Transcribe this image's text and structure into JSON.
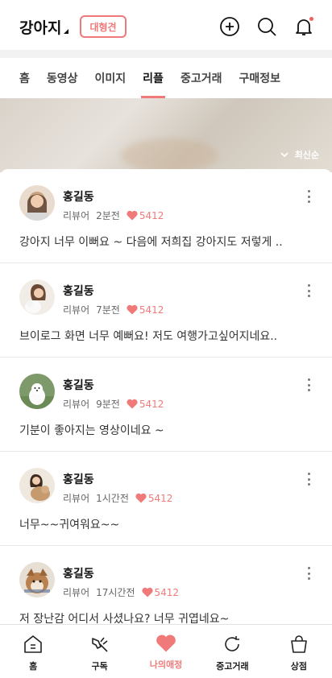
{
  "header": {
    "brand": "강아지",
    "size_chip": "대형견"
  },
  "tabs": [
    {
      "label": "홈",
      "active": false
    },
    {
      "label": "동영상",
      "active": false
    },
    {
      "label": "이미지",
      "active": false
    },
    {
      "label": "리플",
      "active": true
    },
    {
      "label": "중고거래",
      "active": false
    },
    {
      "label": "구매정보",
      "active": false
    }
  ],
  "sort": {
    "label": "최신순"
  },
  "comments": [
    {
      "name": "홍길동",
      "role": "리뷰어",
      "time": "2분전",
      "likes": "5412",
      "text": "강아지 너무 이뻐요 ~ 다음에 저희집 강아지도 저렇게 ..",
      "avatar_color": "#8a6a52"
    },
    {
      "name": "홍길동",
      "role": "리뷰어",
      "time": "7분전",
      "likes": "5412",
      "text": "브이로그 화면 너무 예뻐요! 저도 여행가고싶어지네요..",
      "avatar_color": "#d8c8b8"
    },
    {
      "name": "홍길동",
      "role": "리뷰어",
      "time": "9분전",
      "likes": "5412",
      "text": "기분이 좋아지는 영상이네요 ~",
      "avatar_color": "#7f9a6a"
    },
    {
      "name": "홍길동",
      "role": "리뷰어",
      "time": "1시간전",
      "likes": "5412",
      "text": "너무~~귀여워요~~",
      "avatar_color": "#b89a7a"
    },
    {
      "name": "홍길동",
      "role": "리뷰어",
      "time": "17시간전",
      "likes": "5412",
      "text": "저 장난감 어디서 사셨나요? 너무 귀엽네요~",
      "avatar_color": "#a97a55"
    }
  ],
  "bottom_nav": [
    {
      "label": "홈",
      "icon": "home-icon",
      "active": false
    },
    {
      "label": "구독",
      "icon": "subscribe-icon",
      "active": false
    },
    {
      "label": "나의애정",
      "icon": "heart-icon",
      "active": true
    },
    {
      "label": "중고거래",
      "icon": "refresh-icon",
      "active": false
    },
    {
      "label": "상점",
      "icon": "shopping-bag-icon",
      "active": false
    }
  ],
  "colors": {
    "accent": "#f07a7a",
    "text": "#222222",
    "divider": "#e8e8e8"
  }
}
